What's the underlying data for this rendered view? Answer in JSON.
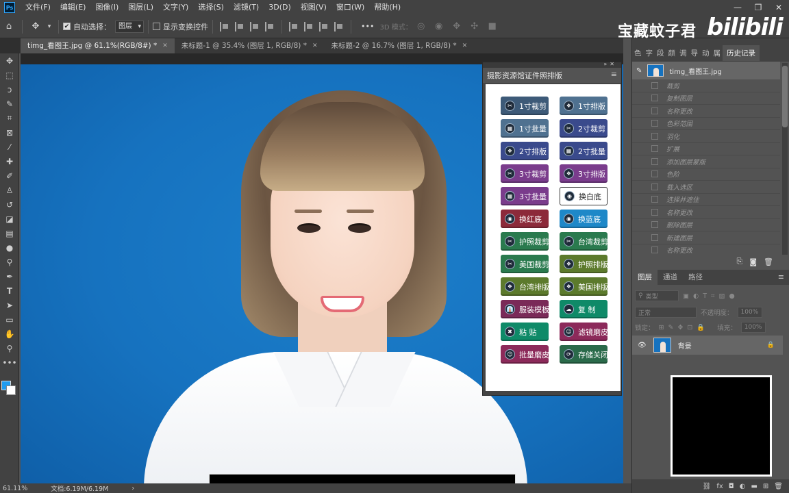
{
  "menu": [
    "文件(F)",
    "编辑(E)",
    "图像(I)",
    "图层(L)",
    "文字(Y)",
    "选择(S)",
    "滤镜(T)",
    "3D(D)",
    "视图(V)",
    "窗口(W)",
    "帮助(H)"
  ],
  "options": {
    "auto_select_label": "自动选择：",
    "auto_select_value": "图层",
    "show_transform_label": "显示变换控件",
    "mode_3d_label": "3D 模式：",
    "more": "•••"
  },
  "tabs": [
    {
      "label": "timg_看图王.jpg @ 61.1%(RGB/8#) *"
    },
    {
      "label": "未标题-1 @ 35.4% (图层 1, RGB/8) *"
    },
    {
      "label": "未标题-2 @ 16.7% (图层 1, RGB/8) *"
    }
  ],
  "watermark": {
    "text": "宝藏蚊子君",
    "brand": "bilibili"
  },
  "float_panel": {
    "title": "摄影资源馆证件照排版",
    "buttons": [
      {
        "label": "1寸裁剪",
        "color": "#3d5a78",
        "icon": "scissors-icon"
      },
      {
        "label": "1寸排版",
        "color": "#4f7190",
        "icon": "layout-icon"
      },
      {
        "label": "1寸批量",
        "color": "#4f7190",
        "icon": "chart-icon"
      },
      {
        "label": "2寸裁剪",
        "color": "#3a4a8c",
        "icon": "scissors-icon"
      },
      {
        "label": "2寸排版",
        "color": "#3a4a8c",
        "icon": "layout-icon"
      },
      {
        "label": "2寸批量",
        "color": "#3a4a8c",
        "icon": "chart-icon"
      },
      {
        "label": "3寸裁剪",
        "color": "#7a3c8c",
        "icon": "scissors-icon"
      },
      {
        "label": "3寸排版",
        "color": "#7a3c8c",
        "icon": "layout-icon"
      },
      {
        "label": "3寸批量",
        "color": "#7a3c8c",
        "icon": "chart-icon"
      },
      {
        "label": "换白底",
        "color": "#ffffff",
        "icon": "film-icon",
        "light": true
      },
      {
        "label": "换红底",
        "color": "#8c2a3a",
        "icon": "film-icon"
      },
      {
        "label": "换蓝底",
        "color": "#1e88c8",
        "icon": "film-icon"
      },
      {
        "label": "护照裁剪",
        "color": "#2a7a4e",
        "icon": "scissors-icon"
      },
      {
        "label": "台湾裁剪",
        "color": "#2a7a4e",
        "icon": "scissors-icon"
      },
      {
        "label": "美国裁剪",
        "color": "#2a7a4e",
        "icon": "scissors-icon"
      },
      {
        "label": "护照排版",
        "color": "#5c7a2c",
        "icon": "layout-icon"
      },
      {
        "label": "台湾排版",
        "color": "#5c7a2c",
        "icon": "layout-icon"
      },
      {
        "label": "美国排版",
        "color": "#5c7a2c",
        "icon": "layout-icon"
      },
      {
        "label": "服装模板",
        "color": "#7a2a58",
        "icon": "shirt-icon"
      },
      {
        "label": "复 制",
        "color": "#0f8a68",
        "icon": "copy-icon"
      },
      {
        "label": "粘 贴",
        "color": "#0f8a68",
        "icon": "paste-icon"
      },
      {
        "label": "滤镜磨皮",
        "color": "#8c2a5a",
        "icon": "person-icon"
      },
      {
        "label": "批量磨皮",
        "color": "#8c2a5a",
        "icon": "person-icon"
      },
      {
        "label": "存储关闭",
        "color": "#2a6a4a",
        "icon": "save-icon"
      }
    ]
  },
  "right_panel": {
    "top_tabs": [
      "色",
      "字",
      "段",
      "颜",
      "调",
      "导",
      "动",
      "属"
    ],
    "active_tab": "历史记录",
    "snapshot": "timg_看图王.jpg",
    "history": [
      "裁剪",
      "复制图层",
      "名称更改",
      "色彩范围",
      "羽化",
      "扩展",
      "添加图层蒙版",
      "色阶",
      "载入选区",
      "选择并遮住",
      "名称更改",
      "删除图层",
      "新建图层",
      "名称更改"
    ]
  },
  "layers": {
    "tabs": [
      "图层",
      "通道",
      "路径"
    ],
    "kind": "类型",
    "blend": "正常",
    "opacity_label": "不透明度：",
    "opacity": "100%",
    "lock_label": "锁定：",
    "fill_label": "填充：",
    "fill": "100%",
    "layer_name": "背景"
  },
  "status": {
    "zoom": "61.11%",
    "doc": "文档:6.19M/6.19M"
  }
}
